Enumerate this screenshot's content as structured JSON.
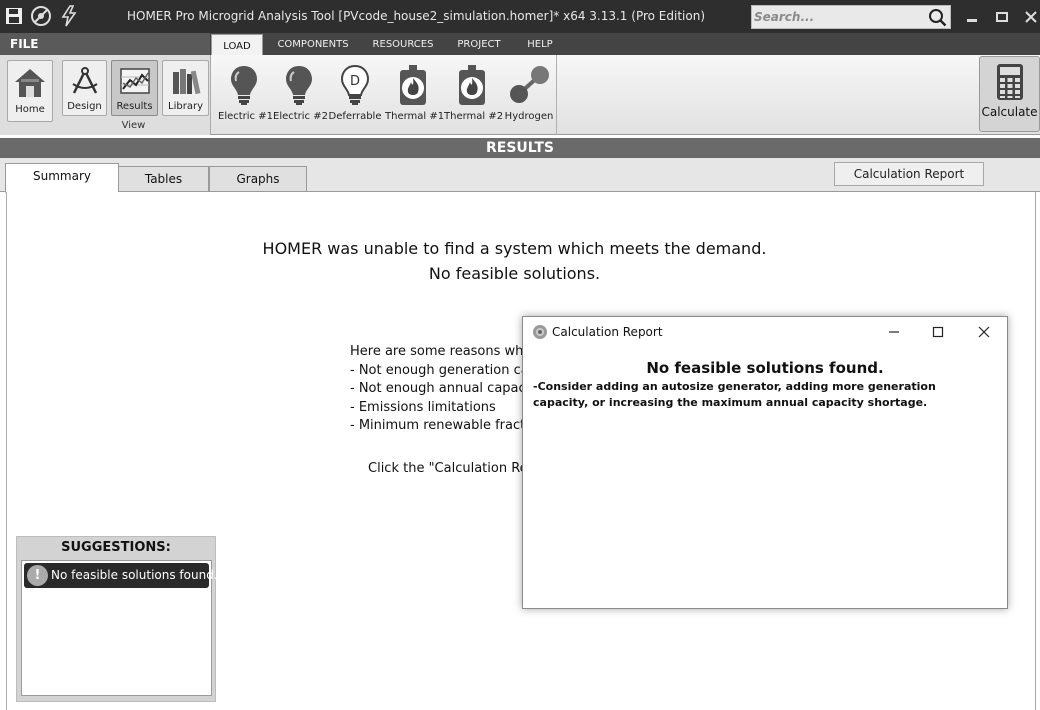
{
  "titlebar": {
    "title": "HOMER Pro Microgrid Analysis Tool [PVcode_house2_simulation.homer]*  x64 3.13.1 (Pro Edition)",
    "search_placeholder": "Search...",
    "quick_access": [
      "save-icon",
      "stop-icon",
      "lightning-icon"
    ],
    "window_controls": [
      "minimize-icon",
      "restore-icon",
      "close-icon"
    ]
  },
  "ribbon": {
    "file_label": "FILE",
    "tabs": [
      {
        "label": "LOAD",
        "active": true
      },
      {
        "label": "COMPONENTS",
        "active": false
      },
      {
        "label": "RESOURCES",
        "active": false
      },
      {
        "label": "PROJECT",
        "active": false
      },
      {
        "label": "HELP",
        "active": false
      }
    ],
    "home_label": "Home",
    "view_group_label": "View",
    "view_buttons": [
      {
        "label": "Design",
        "icon": "design-compass-icon"
      },
      {
        "label": "Results",
        "icon": "results-chart-icon",
        "selected": true
      },
      {
        "label": "Library",
        "icon": "library-books-icon"
      }
    ],
    "load_buttons": [
      {
        "label": "Electric #1",
        "icon": "lightbulb-icon"
      },
      {
        "label": "Electric #2",
        "icon": "lightbulb-icon"
      },
      {
        "label": "Deferrable",
        "icon": "deferrable-bulb-icon",
        "glyph": "D"
      },
      {
        "label": "Thermal #1",
        "icon": "thermal-flame-icon"
      },
      {
        "label": "Thermal #2",
        "icon": "thermal-flame-icon"
      },
      {
        "label": "Hydrogen",
        "icon": "hydrogen-molecule-icon"
      }
    ],
    "calculate_label": "Calculate"
  },
  "results": {
    "header": "RESULTS",
    "tabs": [
      {
        "label": "Summary",
        "active": true
      },
      {
        "label": "Tables",
        "active": false
      },
      {
        "label": "Graphs",
        "active": false
      }
    ],
    "calc_report_button": "Calculation Report"
  },
  "main": {
    "headline_1": "HOMER was unable to find a system which meets the demand.",
    "headline_2": "No feasible solutions.",
    "reasons": [
      "Here are some reasons why",
      "- Not enough generation ca",
      "- Not enough annual capaci",
      "- Emissions limitations",
      "- Minimum renewable fractio"
    ],
    "click_hint": "Click the \"Calculation Rep"
  },
  "suggestions": {
    "title": "SUGGESTIONS:",
    "items": [
      {
        "text": "No feasible solutions found.",
        "icon": "warning-icon"
      }
    ]
  },
  "dialog": {
    "title": "Calculation Report",
    "heading": "No feasible solutions found.",
    "body": "-Consider adding an autosize generator, adding more generation capacity, or increasing the maximum annual capacity shortage."
  },
  "colors": {
    "titlebar_bg": "#2e2e2e",
    "results_bar_bg": "#6a6a6a",
    "suggestion_item_bg": "#2a2a2a"
  }
}
